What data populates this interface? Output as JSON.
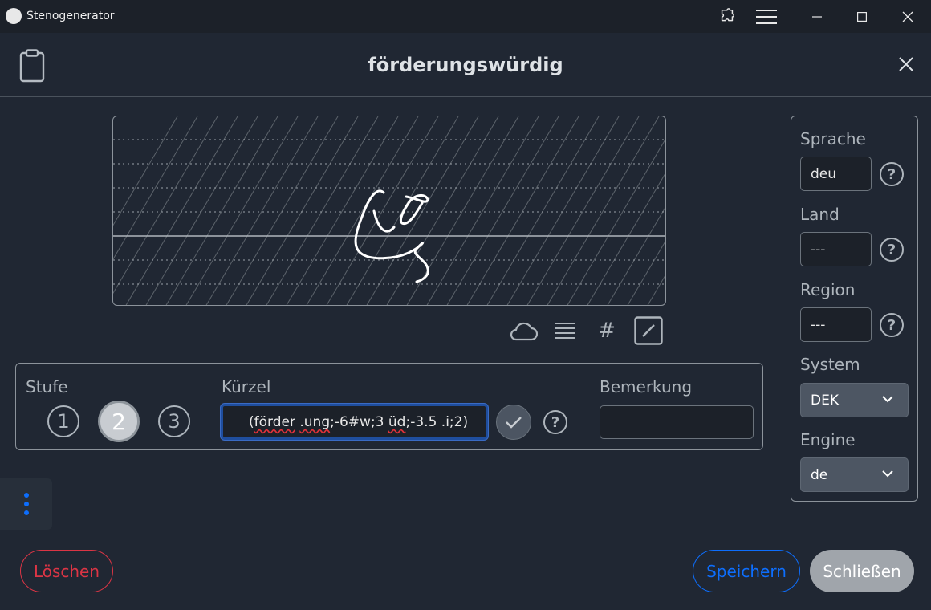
{
  "window": {
    "app_title": "Stenogenerator"
  },
  "header": {
    "title": "förderungswürdig"
  },
  "stufe": {
    "label": "Stufe",
    "options": [
      "1",
      "2",
      "3"
    ],
    "selected": "2"
  },
  "kuerzel": {
    "label": "Kürzel",
    "value_parts": [
      "(",
      "förder",
      " ",
      ".ung",
      ";-6#w;3 ",
      "üd",
      ";-3.5 .i;2)"
    ]
  },
  "bemerkung": {
    "label": "Bemerkung",
    "value": ""
  },
  "sidebar": {
    "sprache": {
      "label": "Sprache",
      "value": "deu"
    },
    "land": {
      "label": "Land",
      "value": "---"
    },
    "region": {
      "label": "Region",
      "value": "---"
    },
    "system": {
      "label": "System",
      "value": "DEK"
    },
    "engine": {
      "label": "Engine",
      "value": "de"
    }
  },
  "tools": {
    "hash_glyph": "#"
  },
  "help_glyph": "?",
  "footer": {
    "delete_label": "Löschen",
    "save_label": "Speichern",
    "close_label": "Schließen"
  },
  "colors": {
    "danger": "#dc3545",
    "primary": "#0d6efd",
    "background": "#202733"
  }
}
